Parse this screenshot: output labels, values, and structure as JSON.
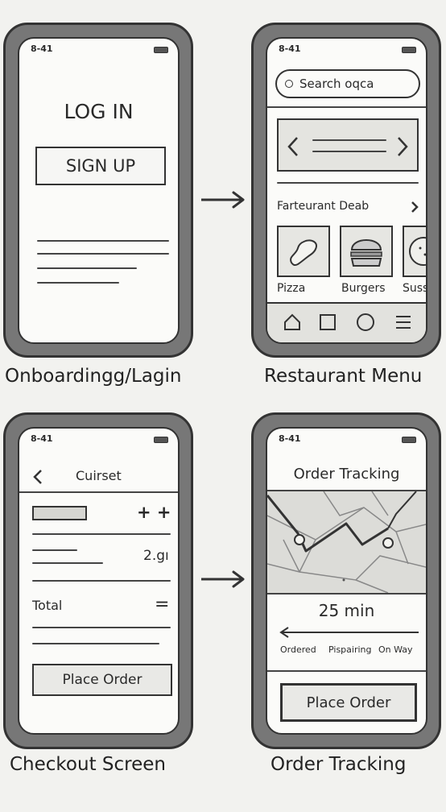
{
  "status_time": "8-41",
  "screens": {
    "login": {
      "title": "LOG IN",
      "signup_label": "SIGN UP",
      "caption": "Onboardingg/Lagin"
    },
    "menu": {
      "search_placeholder": "Search oqca",
      "featured_label": "Farteurant Deab",
      "categories": [
        "Pizza",
        "Burgers",
        "Suss"
      ],
      "caption": "Restaurant Menu"
    },
    "checkout": {
      "header_title": "Cuirset",
      "qty_label": "+ +",
      "price": "2.gı",
      "total_label": "Total",
      "total_value": "=",
      "place_order_label": "Place Order",
      "caption": "Checkout Screen"
    },
    "tracking": {
      "title": "Order Tracking",
      "eta": "25 min",
      "steps": [
        "Ordered",
        "Pispairing",
        "On Way"
      ],
      "place_order_label": "Place Order",
      "caption": "Order Tracking"
    }
  },
  "icons": {
    "back": "chevron-left-icon",
    "slider_left": "chevron-left-icon",
    "slider_right": "chevron-right-icon",
    "nav": [
      "home-icon",
      "square-icon",
      "circle-icon",
      "menu-icon"
    ]
  }
}
